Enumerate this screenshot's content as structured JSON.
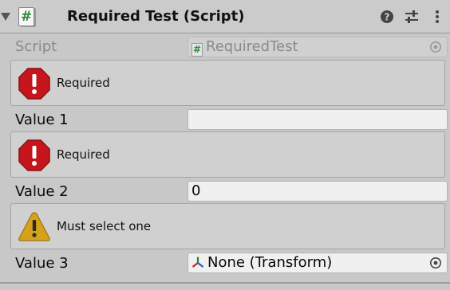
{
  "header": {
    "foldout_icon": "triangle-down-icon",
    "script_icon_glyph": "#",
    "title": "Required Test (Script)",
    "icons": [
      "help-icon",
      "preset-sliders-icon",
      "kebab-menu-icon"
    ]
  },
  "script_row": {
    "label": "Script",
    "icon_glyph": "#",
    "value": "RequiredTest"
  },
  "help_boxes": [
    {
      "type": "error",
      "icon": "error-octagon-icon",
      "message": "Required"
    },
    {
      "type": "error",
      "icon": "error-octagon-icon",
      "message": "Required"
    },
    {
      "type": "warning",
      "icon": "warning-triangle-icon",
      "message": "Must select one"
    }
  ],
  "fields": [
    {
      "label": "Value 1",
      "value": ""
    },
    {
      "label": "Value 2",
      "value": "0"
    },
    {
      "label": "Value 3",
      "value": "None (Transform)",
      "icon": "transform-axes-icon"
    }
  ],
  "colors": {
    "background": "#c8c8c8",
    "error_red": "#c4161c",
    "warning_yellow": "#d6a21a",
    "script_green": "#2f8a3a"
  }
}
